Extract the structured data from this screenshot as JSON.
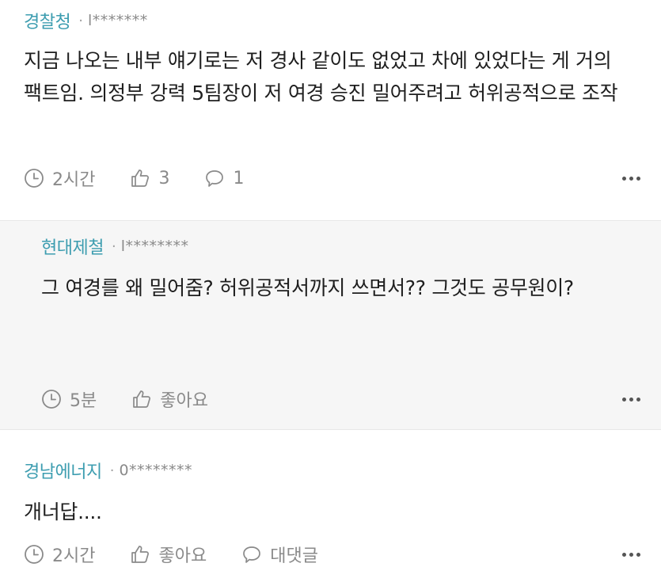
{
  "comments": [
    {
      "author": "경찰청",
      "separator": "·",
      "user_id": "l*******",
      "text": "지금 나오는 내부 얘기로는 저 경사 같이도 없었고 차에 있었다는 게 거의 팩트임. 의정부 강력 5팀장이 저 여경 승진 밀어주려고 허위공적으로 조작",
      "time": "2시간",
      "likes": "3",
      "replies": "1"
    },
    {
      "author": "현대제철",
      "separator": "·",
      "user_id": "l********",
      "text": "그 여경를 왜 밀어줌? 허위공적서까지 쓰면서?? 그것도 공무원이?",
      "time": "5분",
      "likes": "좋아요"
    },
    {
      "author": "경남에너지",
      "separator": "·",
      "user_id": "0********",
      "text": "개너답....",
      "time": "2시간",
      "likes": "좋아요",
      "replies": "대댓글"
    }
  ],
  "icons": {
    "clock": "clock-icon",
    "like": "thumbs-up-icon",
    "reply": "speech-bubble-icon",
    "more": "more-options-icon"
  },
  "colors": {
    "author": "#3d9db0",
    "meta": "#8a8a8a",
    "reply_bg": "#f6f6f6"
  }
}
